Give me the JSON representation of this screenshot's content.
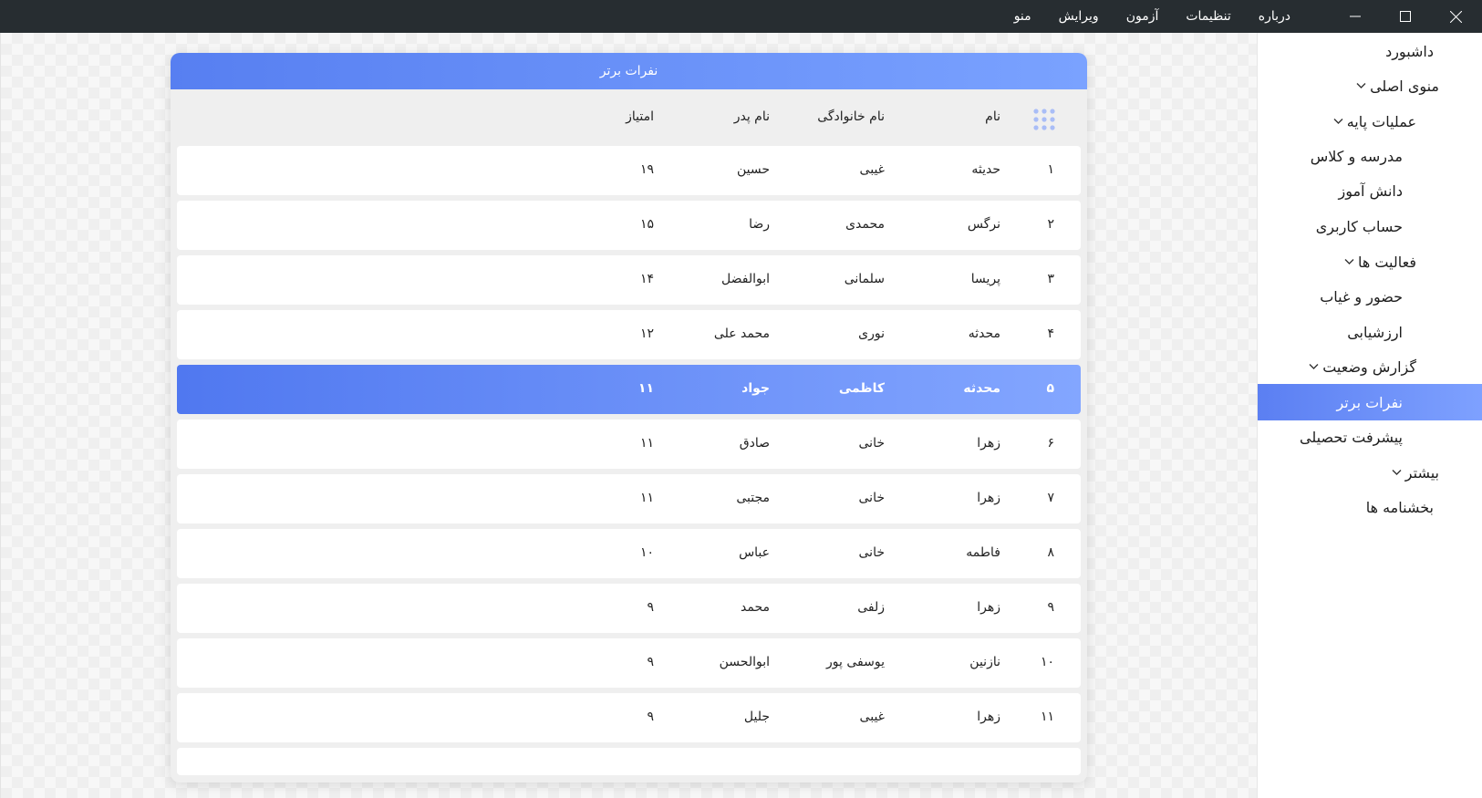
{
  "window": {
    "menu": [
      "منو",
      "ویرایش",
      "آزمون",
      "تنظیمات",
      "درباره"
    ]
  },
  "sidebar": {
    "items": [
      {
        "label": "داشبورد",
        "chevron": false,
        "level": 0
      },
      {
        "label": "منوی اصلی",
        "chevron": true,
        "level": 0
      },
      {
        "label": "عملیات پایه",
        "chevron": true,
        "level": 1
      },
      {
        "label": "مدرسه و کلاس",
        "chevron": false,
        "level": 2
      },
      {
        "label": "دانش آموز",
        "chevron": false,
        "level": 2
      },
      {
        "label": "حساب کاربری",
        "chevron": false,
        "level": 2
      },
      {
        "label": "فعالیت ها",
        "chevron": true,
        "level": 1
      },
      {
        "label": "حضور و غیاب",
        "chevron": false,
        "level": 2
      },
      {
        "label": "ارزشیابی",
        "chevron": false,
        "level": 2
      },
      {
        "label": "گزارش وضعیت",
        "chevron": true,
        "level": 1
      },
      {
        "label": "نفرات برتر",
        "chevron": false,
        "level": 2,
        "active": true
      },
      {
        "label": "پیشرفت تحصیلی",
        "chevron": false,
        "level": 2
      },
      {
        "label": "بیشتر",
        "chevron": true,
        "level": 0
      },
      {
        "label": "بخشنامه ها",
        "chevron": false,
        "level": 1
      }
    ]
  },
  "card": {
    "title": "نفرات برتر",
    "columns": {
      "name": "نام",
      "family": "نام خانوادگی",
      "father": "نام پدر",
      "score": "امتیاز"
    },
    "rows": [
      {
        "idx": "۱",
        "name": "حدیثه",
        "family": "غیبی",
        "father": "حسین",
        "score": "۱۹"
      },
      {
        "idx": "۲",
        "name": "نرگس",
        "family": "محمدی",
        "father": "رضا",
        "score": "۱۵"
      },
      {
        "idx": "۳",
        "name": "پریسا",
        "family": "سلمانی",
        "father": "ابوالفضل",
        "score": "۱۴"
      },
      {
        "idx": "۴",
        "name": "محدثه",
        "family": "نوری",
        "father": "محمد علی",
        "score": "۱۲"
      },
      {
        "idx": "۵",
        "name": "محدثه",
        "family": "کاظمی",
        "father": "جواد",
        "score": "۱۱",
        "selected": true
      },
      {
        "idx": "۶",
        "name": "زهرا",
        "family": "خانی",
        "father": "صادق",
        "score": "۱۱"
      },
      {
        "idx": "۷",
        "name": "زهرا",
        "family": "خانی",
        "father": "مجتبی",
        "score": "۱۱"
      },
      {
        "idx": "۸",
        "name": "فاطمه",
        "family": "خانی",
        "father": "عباس",
        "score": "۱۰"
      },
      {
        "idx": "۹",
        "name": "زهرا",
        "family": "زلفی",
        "father": "محمد",
        "score": "۹"
      },
      {
        "idx": "۱۰",
        "name": "نازنین",
        "family": "یوسفی پور",
        "father": "ابوالحسن",
        "score": "۹"
      },
      {
        "idx": "۱۱",
        "name": "زهرا",
        "family": "غیبی",
        "father": "جلیل",
        "score": "۹"
      }
    ]
  },
  "colors": {
    "accent": "#5b7ff2",
    "titlebar": "#272d31"
  }
}
